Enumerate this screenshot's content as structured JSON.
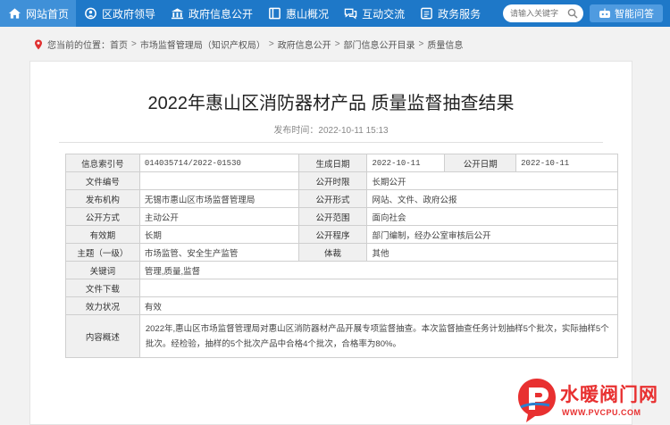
{
  "nav": {
    "items": [
      {
        "label": "网站首页",
        "icon": "home-icon"
      },
      {
        "label": "区政府领导",
        "icon": "leader-icon"
      },
      {
        "label": "政府信息公开",
        "icon": "building-icon"
      },
      {
        "label": "惠山概况",
        "icon": "book-icon"
      },
      {
        "label": "互动交流",
        "icon": "chat-icon"
      },
      {
        "label": "政务服务",
        "icon": "service-icon"
      }
    ],
    "search_placeholder": "请输入关键字",
    "smart_label": "智能问答"
  },
  "breadcrumb": {
    "prefix": "您当前的位置：",
    "items": [
      "首页",
      "市场监督管理局（知识产权局）",
      "政府信息公开",
      "部门信息公开目录",
      "质量信息"
    ]
  },
  "article": {
    "title": "2022年惠山区消防器材产品 质量监督抽查结果",
    "pubdate": "发布时间：2022-10-11 15:13"
  },
  "meta": {
    "index_label": "信息索引号",
    "index_value": "014035714/2022-01530",
    "created_label": "生成日期",
    "created_value": "2022-10-11",
    "opened_label": "公开日期",
    "opened_value": "2022-10-11",
    "docno_label": "文件编号",
    "docno_value": "",
    "limit_label": "公开时限",
    "limit_value": "长期公开",
    "org_label": "发布机构",
    "org_value": "无锡市惠山区市场监督管理局",
    "form_label": "公开形式",
    "form_value": "网站、文件、政府公报",
    "way_label": "公开方式",
    "way_value": "主动公开",
    "scope_label": "公开范围",
    "scope_value": "面向社会",
    "valid_label": "有效期",
    "valid_value": "长期",
    "proc_label": "公开程序",
    "proc_value": "部门编制，经办公室审核后公开",
    "topic_label": "主题（一级）",
    "topic_value": "市场监管、安全生产监管",
    "genre_label": "体裁",
    "genre_value": "其他",
    "kw_label": "关键词",
    "kw_value": "管理,质量,监督",
    "download_label": "文件下载",
    "download_value": "",
    "status_label": "效力状况",
    "status_value": "有效",
    "summary_label": "内容概述",
    "summary_value": "2022年,惠山区市场监督管理局对惠山区消防器材产品开展专项监督抽查。本次监督抽查任务计划抽样5个批次，实际抽样5个批次。经检验，抽样的5个批次产品中合格4个批次，合格率为80%。"
  },
  "watermark": {
    "text": "水暖阀门网",
    "url": "WWW.PVCPU.COM"
  },
  "colors": {
    "nav_bg": "#1e78c8",
    "nav_active": "#3f90d8",
    "watermark": "#e83030"
  }
}
